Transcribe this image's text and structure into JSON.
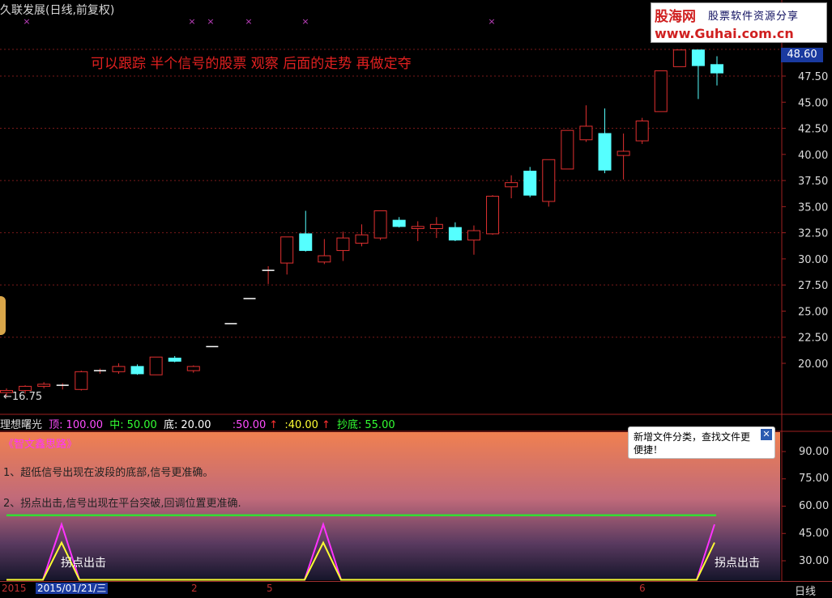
{
  "window": {
    "title": "久联发展(日线,前复权)"
  },
  "logo": {
    "brand": "股海网",
    "tagline": "股票软件资源分享",
    "url": "www.Guhai.com.cn"
  },
  "annotation": "可以跟踪 半个信号的股票 观察 后面的走势 再做定夺",
  "price_axis": {
    "ticks": [
      "47.50",
      "45.00",
      "42.50",
      "40.00",
      "37.50",
      "35.00",
      "32.50",
      "30.00",
      "27.50",
      "25.00",
      "22.50",
      "20.00"
    ],
    "current_price": "48.60",
    "low_marker": "←16.75"
  },
  "indicator": {
    "name": "理想曙光",
    "top_label": "顶:",
    "top_value": "100.00",
    "mid_label": "中:",
    "mid_value": "50.00",
    "bottom_label": "底:",
    "bottom_value": "20.00",
    "v1": ":50.00",
    "v2": ":40.00",
    "buy_label": "抄底:",
    "buy_value": "55.00",
    "up_arrow": "↑",
    "colors": {
      "top": "#ff4dff",
      "mid": "#33ff33",
      "bottom": "#ffffff",
      "v1": "#ff4dff",
      "v2": "#ffff33",
      "buy": "#33ff33",
      "arrow": "#ff3030"
    }
  },
  "subpanel": {
    "title": "《智文鑫思路》",
    "note1": "1、超低信号出现在波段的底部,信号更准确。",
    "note2": "2、拐点出击,信号出现在平台突破,回调位置更准确.",
    "signal_labels": [
      "拐点出击",
      "拐点出击"
    ],
    "axis_ticks": [
      "90.00",
      "75.00",
      "60.00",
      "45.00",
      "30.00"
    ],
    "green_line_value": 55
  },
  "tooltip": {
    "text": "新增文件分类，查找文件更便捷！",
    "close_icon": "close-icon"
  },
  "bottombar": {
    "year": "2015",
    "current_date": "2015/01/21/三",
    "month_labels": [
      "2",
      "5",
      "6"
    ],
    "period": "日线"
  },
  "chart_data": {
    "type": "candlestick",
    "y_range": [
      15.5,
      50
    ],
    "candles": [
      {
        "o": 17.2,
        "h": 17.6,
        "l": 16.75,
        "c": 17.4
      },
      {
        "o": 17.4,
        "h": 17.9,
        "l": 17.1,
        "c": 17.8
      },
      {
        "o": 17.8,
        "h": 18.2,
        "l": 17.6,
        "c": 18.0
      },
      {
        "o": 17.8,
        "h": 18.1,
        "l": 17.5,
        "c": 17.9
      },
      {
        "o": 17.5,
        "h": 19.3,
        "l": 17.4,
        "c": 19.2
      },
      {
        "o": 19.2,
        "h": 19.5,
        "l": 19.0,
        "c": 19.3
      },
      {
        "o": 19.2,
        "h": 20.0,
        "l": 19.0,
        "c": 19.7
      },
      {
        "o": 19.7,
        "h": 19.9,
        "l": 18.9,
        "c": 19.0
      },
      {
        "o": 18.9,
        "h": 20.6,
        "l": 18.9,
        "c": 20.6
      },
      {
        "o": 20.5,
        "h": 20.7,
        "l": 20.1,
        "c": 20.2
      },
      {
        "o": 19.3,
        "h": 19.8,
        "l": 19.1,
        "c": 19.7
      },
      {
        "o": 21.6,
        "h": 21.6,
        "l": 21.6,
        "c": 21.6
      },
      {
        "o": 23.8,
        "h": 23.8,
        "l": 23.8,
        "c": 23.8
      },
      {
        "o": 26.2,
        "h": 26.2,
        "l": 26.2,
        "c": 26.2
      },
      {
        "o": 28.8,
        "h": 29.3,
        "l": 27.6,
        "c": 28.9
      },
      {
        "o": 29.6,
        "h": 31.9,
        "l": 28.5,
        "c": 32.1
      },
      {
        "o": 32.4,
        "h": 34.6,
        "l": 30.7,
        "c": 30.8
      },
      {
        "o": 29.7,
        "h": 31.9,
        "l": 29.5,
        "c": 30.3
      },
      {
        "o": 30.8,
        "h": 32.6,
        "l": 29.8,
        "c": 32.0
      },
      {
        "o": 31.5,
        "h": 33.3,
        "l": 31.2,
        "c": 32.3
      },
      {
        "o": 32.0,
        "h": 34.5,
        "l": 31.8,
        "c": 34.6
      },
      {
        "o": 33.7,
        "h": 34.0,
        "l": 33.0,
        "c": 33.1
      },
      {
        "o": 32.9,
        "h": 33.6,
        "l": 31.7,
        "c": 33.1
      },
      {
        "o": 32.9,
        "h": 34.0,
        "l": 32.0,
        "c": 33.3
      },
      {
        "o": 33.0,
        "h": 33.5,
        "l": 31.7,
        "c": 31.8
      },
      {
        "o": 31.8,
        "h": 33.2,
        "l": 30.4,
        "c": 32.7
      },
      {
        "o": 32.4,
        "h": 36.1,
        "l": 32.3,
        "c": 36.0
      },
      {
        "o": 36.9,
        "h": 38.0,
        "l": 35.8,
        "c": 37.3
      },
      {
        "o": 38.4,
        "h": 38.8,
        "l": 35.9,
        "c": 36.1
      },
      {
        "o": 35.5,
        "h": 39.5,
        "l": 35.0,
        "c": 39.5
      },
      {
        "o": 38.6,
        "h": 42.3,
        "l": 38.6,
        "c": 42.3
      },
      {
        "o": 41.4,
        "h": 44.7,
        "l": 41.2,
        "c": 42.7
      },
      {
        "o": 42.0,
        "h": 44.4,
        "l": 38.2,
        "c": 38.5
      },
      {
        "o": 39.9,
        "h": 42.0,
        "l": 37.6,
        "c": 40.3
      },
      {
        "o": 41.3,
        "h": 43.5,
        "l": 41.0,
        "c": 43.2
      },
      {
        "o": 44.1,
        "h": 48.0,
        "l": 44.1,
        "c": 48.0
      },
      {
        "o": 48.4,
        "h": 50.0,
        "l": 48.4,
        "c": 50.0
      },
      {
        "o": 50.0,
        "h": 50.0,
        "l": 45.3,
        "c": 48.5
      },
      {
        "o": 48.6,
        "h": 49.4,
        "l": 46.6,
        "c": 47.8
      }
    ],
    "top_markers": [
      "×",
      "×",
      "×",
      "×",
      "×",
      "×"
    ],
    "signal_series": [
      {
        "name": "顶",
        "values": [
          20,
          20,
          20,
          20,
          20,
          20,
          20,
          20,
          20,
          20,
          20,
          20,
          20,
          20,
          20,
          20,
          20,
          20,
          20,
          20,
          20,
          20,
          20,
          20,
          20,
          20,
          20,
          20,
          20,
          20,
          20,
          20,
          20,
          20,
          20,
          20,
          20,
          20,
          20,
          20
        ]
      }
    ]
  }
}
